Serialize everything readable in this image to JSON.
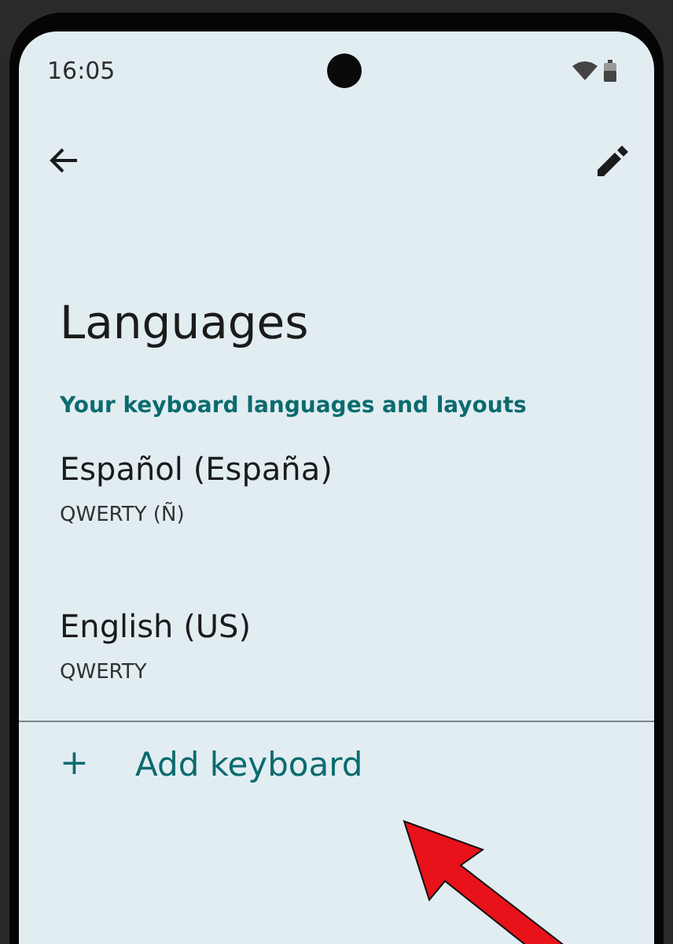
{
  "status_bar": {
    "time": "16:05"
  },
  "title": "Languages",
  "section_header": "Your keyboard languages and layouts",
  "keyboards": [
    {
      "language": "Español (España)",
      "layout": "QWERTY (Ñ)"
    },
    {
      "language": "English (US)",
      "layout": "QWERTY"
    }
  ],
  "add_action": {
    "icon": "+",
    "label": "Add keyboard"
  }
}
